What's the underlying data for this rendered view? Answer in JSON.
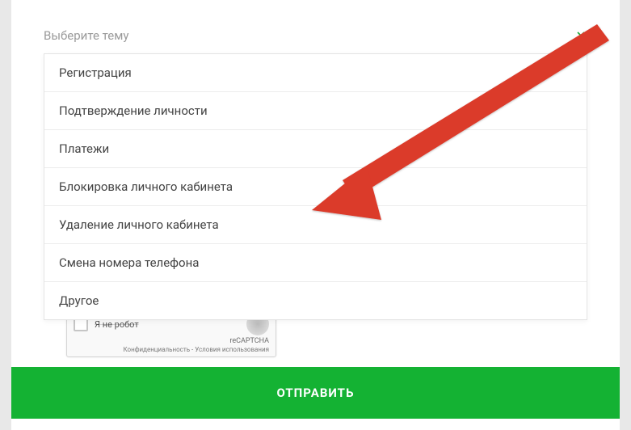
{
  "select": {
    "placeholder": "Выберите тему",
    "options": [
      "Регистрация",
      "Подтверждение личности",
      "Платежи",
      "Блокировка личного кабинета",
      "Удаление личного кабинета",
      "Смена номера телефона",
      "Другое"
    ]
  },
  "recaptcha": {
    "label": "Я не робот",
    "brand": "reCAPTCHA",
    "terms": "Конфиденциальность - Условия использования"
  },
  "submit": {
    "label": "ОТПРАВИТЬ"
  },
  "colors": {
    "accent_green": "#14b233",
    "arrow_red": "#db3a2c"
  }
}
